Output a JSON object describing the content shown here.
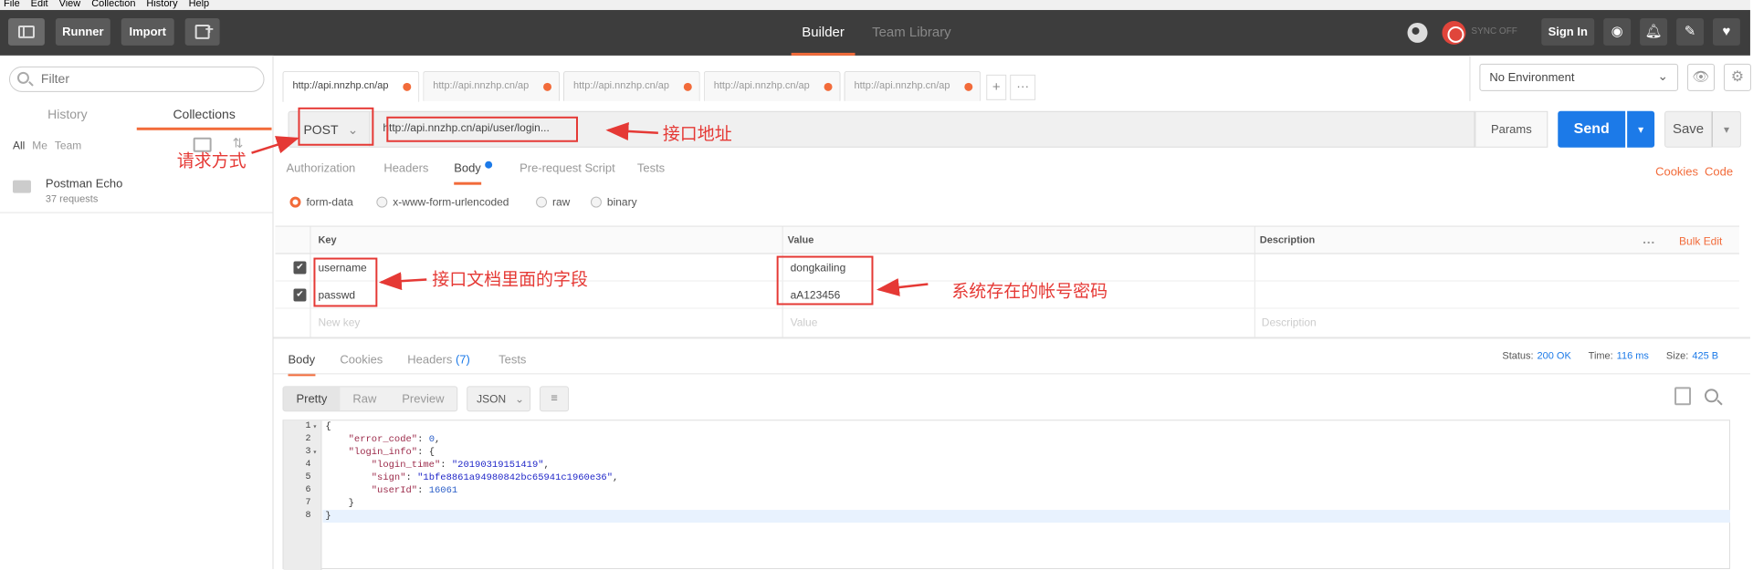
{
  "menubar": [
    "File",
    "Edit",
    "View",
    "Collection",
    "History",
    "Help"
  ],
  "header": {
    "runner": "Runner",
    "import": "Import",
    "tab_builder": "Builder",
    "tab_team": "Team Library",
    "sync_text": "SYNC OFF",
    "signin": "Sign In"
  },
  "sidebar": {
    "filter_placeholder": "Filter",
    "tab_history": "History",
    "tab_collections": "Collections",
    "sub_all": "All",
    "sub_me": "Me",
    "sub_team": "Team",
    "collection_name": "Postman Echo",
    "collection_count": "37 requests"
  },
  "tabs": [
    "http://api.nnzhp.cn/ap",
    "http://api.nnzhp.cn/ap",
    "http://api.nnzhp.cn/ap",
    "http://api.nnzhp.cn/ap",
    "http://api.nnzhp.cn/ap"
  ],
  "environment": "No Environment",
  "request": {
    "method": "POST",
    "url": "http://api.nnzhp.cn/api/user/login...",
    "params": "Params",
    "send": "Send",
    "save": "Save",
    "tabs": {
      "authorization": "Authorization",
      "headers": "Headers",
      "body": "Body",
      "prerequest": "Pre-request Script",
      "tests": "Tests"
    },
    "cookies": "Cookies",
    "code": "Code",
    "body_types": [
      "form-data",
      "x-www-form-urlencoded",
      "raw",
      "binary"
    ],
    "kv": {
      "head_key": "Key",
      "head_value": "Value",
      "head_desc": "Description",
      "bulk_edit": "Bulk Edit",
      "rows": [
        {
          "key": "username",
          "value": "dongkailing"
        },
        {
          "key": "passwd",
          "value": "aA123456"
        }
      ],
      "new_key": "New key",
      "new_value": "Value",
      "new_desc": "Description"
    }
  },
  "response": {
    "tabs": {
      "body": "Body",
      "cookies": "Cookies",
      "headers": "Headers",
      "headers_count": "(7)",
      "tests": "Tests"
    },
    "status_label": "Status:",
    "status": "200 OK",
    "time_label": "Time:",
    "time": "116 ms",
    "size_label": "Size:",
    "size": "425 B",
    "formats": [
      "Pretty",
      "Raw",
      "Preview"
    ],
    "format_type": "JSON",
    "code_lines": [
      "{",
      "    \"error_code\": 0,",
      "    \"login_info\": {",
      "        \"login_time\": \"20190319151419\",",
      "        \"sign\": \"1bfe8861a94980842bc65941c1960e36\",",
      "        \"userId\": 16061",
      "    }",
      "}"
    ]
  },
  "annotations": {
    "method_label": "请求方式",
    "url_label": "接口地址",
    "fields_label": "接口文档里面的字段",
    "account_label": "系统存在的帐号密码"
  },
  "colors": {
    "accent": "#f26b3a",
    "send_blue": "#1c7ae8",
    "annotation_red": "#e53935"
  }
}
